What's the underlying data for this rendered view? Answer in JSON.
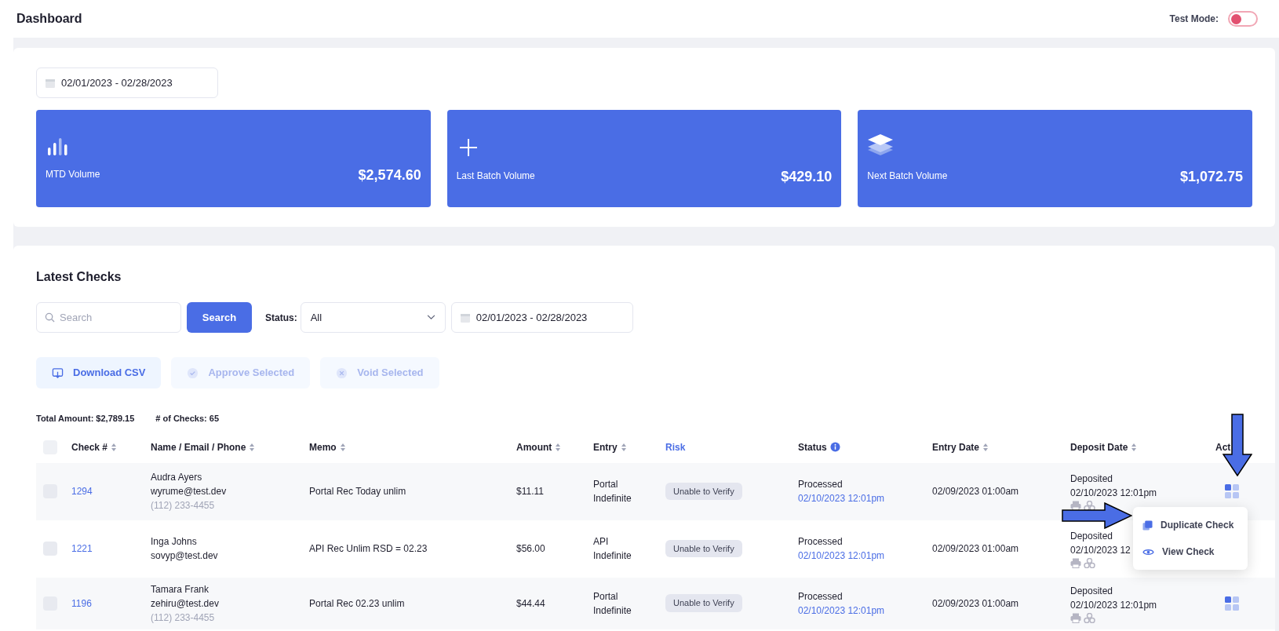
{
  "header": {
    "title": "Dashboard",
    "test_mode": {
      "label": "Test Mode:",
      "on": false
    }
  },
  "summary": {
    "date_range": "02/01/2023 - 02/28/2023",
    "cards": [
      {
        "kind": "bars",
        "label": "MTD Volume",
        "value": "$2,574.60"
      },
      {
        "kind": "plus",
        "label": "Last Batch Volume",
        "value": "$429.10"
      },
      {
        "kind": "layers",
        "label": "Next Batch Volume",
        "value": "$1,072.75"
      }
    ]
  },
  "latest_checks": {
    "title": "Latest Checks",
    "search": {
      "placeholder": "Search",
      "button": "Search"
    },
    "status_filter": {
      "label": "Status:",
      "value": "All"
    },
    "date_range": "02/01/2023 - 02/28/2023",
    "actions": [
      {
        "kind": "download",
        "label": "Download CSV",
        "disabled": false
      },
      {
        "kind": "approve",
        "label": "Approve Selected",
        "disabled": true
      },
      {
        "kind": "void",
        "label": "Void Selected",
        "disabled": true
      }
    ],
    "totals": [
      {
        "label": "Total Amount: $2,789.15"
      },
      {
        "label": "# of Checks: 65"
      }
    ],
    "table": {
      "select_all_checked": false,
      "columns": [
        {
          "label": "Check #",
          "sortable": true,
          "kind": "plain"
        },
        {
          "label": "Name / Email / Phone",
          "sortable": true,
          "kind": "plain"
        },
        {
          "label": "Memo",
          "sortable": true,
          "kind": "plain"
        },
        {
          "label": "Amount",
          "sortable": true,
          "kind": "plain"
        },
        {
          "label": "Entry",
          "sortable": true,
          "kind": "plain"
        },
        {
          "label": "Risk",
          "sortable": false,
          "kind": "link"
        },
        {
          "label": "Status",
          "sortable": false,
          "kind": "info"
        },
        {
          "label": "Entry Date",
          "sortable": true,
          "kind": "plain"
        },
        {
          "label": "Deposit Date",
          "sortable": true,
          "kind": "plain"
        },
        {
          "label": "Act",
          "sortable": false,
          "kind": "plain"
        }
      ],
      "rows": [
        {
          "checked": false,
          "check_no": "1294",
          "name": "Audra Ayers",
          "email": "wyrume@test.dev",
          "phone": "(112) 233-4455",
          "memo": "Portal Rec Today unlim",
          "amount": "$11.11",
          "entry": [
            "Portal",
            "Indefinite"
          ],
          "risk": "Unable to Verify",
          "status": "Processed",
          "status_date": "02/10/2023 12:01pm",
          "entry_date": "02/09/2023 01:00am",
          "deposit_status": "Deposited",
          "deposit_date": "02/10/2023 12:01pm",
          "action_button": true
        },
        {
          "checked": false,
          "check_no": "1221",
          "name": "Inga Johns",
          "email": "sovyp@test.dev",
          "memo": "API Rec Unlim RSD = 02.23",
          "amount": "$56.00",
          "entry": [
            "API",
            "Indefinite"
          ],
          "risk": "Unable to Verify",
          "status": "Processed",
          "status_date": "02/10/2023 12:01pm",
          "entry_date": "02/09/2023 01:00am",
          "deposit_status": "Deposited",
          "deposit_date": "02/10/2023 12",
          "action_button": false
        },
        {
          "checked": false,
          "check_no": "1196",
          "name": "Tamara Frank",
          "email": "zehiru@test.dev",
          "phone": "(112) 233-4455",
          "memo": "Portal Rec 02.23 unlim",
          "amount": "$44.44",
          "entry": [
            "Portal",
            "Indefinite"
          ],
          "risk": "Unable to Verify",
          "status": "Processed",
          "status_date": "02/10/2023 12:01pm",
          "entry_date": "02/09/2023 01:00am",
          "deposit_status": "Deposited",
          "deposit_date": "02/10/2023 12:01pm",
          "action_button": true
        }
      ]
    },
    "action_menu": {
      "items": [
        {
          "kind": "duplicate",
          "label": "Duplicate Check"
        },
        {
          "kind": "view",
          "label": "View Check"
        }
      ]
    }
  }
}
